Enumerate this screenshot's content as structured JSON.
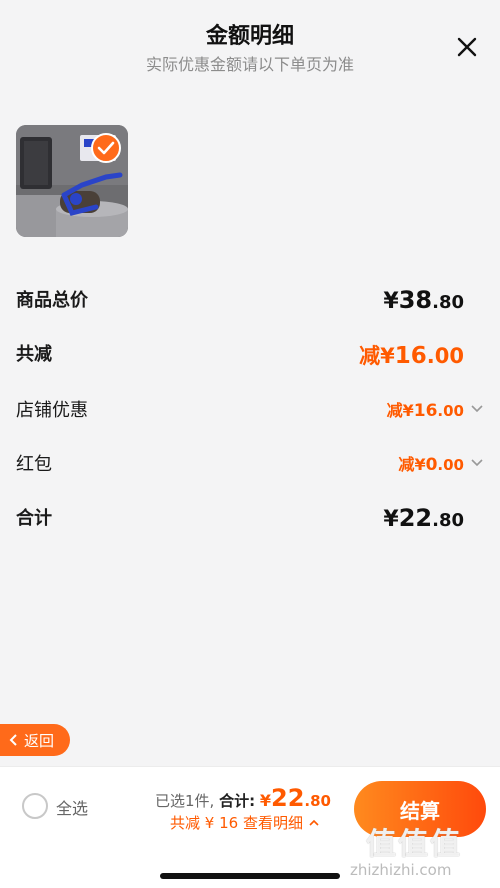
{
  "header": {
    "title": "金额明细",
    "subtitle": "实际优惠金额请以下单页为准"
  },
  "rows": [
    {
      "label": "商品总价",
      "currency": "¥",
      "int": "38",
      "dec": ".80",
      "prefix": "",
      "style": "black"
    },
    {
      "label": "共减",
      "currency": "¥",
      "int": "16",
      "dec": ".00",
      "prefix": "减",
      "style": "orange-big"
    },
    {
      "label": "店铺优惠",
      "currency": "¥",
      "int": "16",
      "dec": ".00",
      "prefix": "减",
      "style": "orange-small"
    },
    {
      "label": "红包",
      "currency": "¥",
      "int": "0",
      "dec": ".00",
      "prefix": "减",
      "style": "orange-small"
    },
    {
      "label": "合计",
      "currency": "¥",
      "int": "22",
      "dec": ".80",
      "prefix": "",
      "style": "black"
    }
  ],
  "back_button": {
    "label": "返回"
  },
  "bottom_bar": {
    "select_all": "全选",
    "selected_count": "已选1件,",
    "total_label": "合计:",
    "total_currency": "¥",
    "total_int": "22",
    "total_dec": ".80",
    "saving_text": "共减 ¥ 16",
    "view_detail": "查看明细",
    "checkout": "结算"
  },
  "watermark": {
    "brand": "值值值",
    "url": "zhizhizhi.com"
  },
  "colors": {
    "accent": "#ff5a00",
    "checkout_start": "#ff8a1e",
    "checkout_end": "#ff4a0c"
  },
  "icons": {
    "close": "close-icon",
    "chevron": "chevron-down-icon",
    "check": "check-icon",
    "back": "chevron-left-icon",
    "up": "chevron-up-icon"
  }
}
